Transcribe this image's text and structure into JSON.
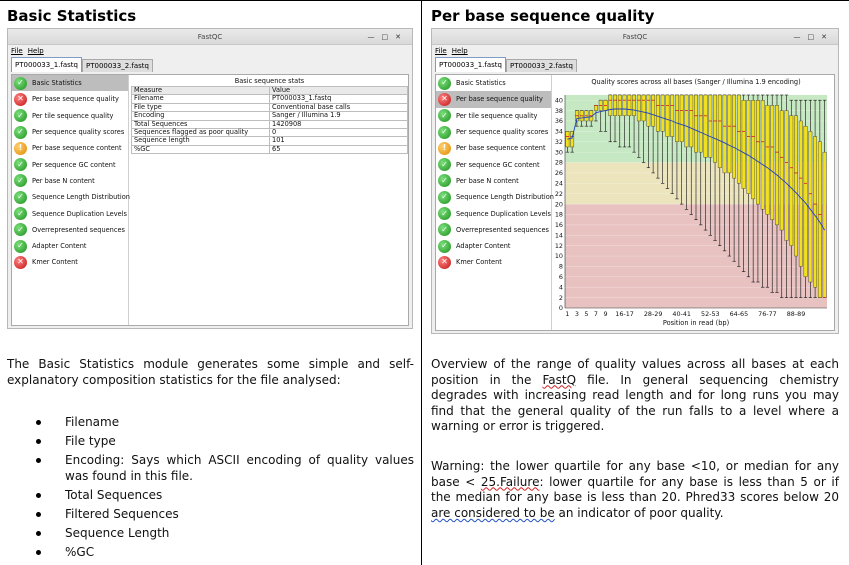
{
  "left": {
    "heading": "Basic Statistics",
    "window": {
      "title": "FastQC",
      "controls": [
        "—",
        "□",
        "✕"
      ],
      "menu": [
        "File",
        "Help"
      ],
      "tabs": [
        "PT000033_1.fastq",
        "PT000033_2.fastq"
      ],
      "stats": {
        "caption": "Basic sequence stats",
        "columns": [
          "Measure",
          "Value"
        ],
        "rows": [
          [
            "Filename",
            "PT000033_1.fastq"
          ],
          [
            "File type",
            "Conventional base calls"
          ],
          [
            "Encoding",
            "Sanger / Illumina 1.9"
          ],
          [
            "Total Sequences",
            "1420908"
          ],
          [
            "Sequences flagged as poor quality",
            "0"
          ],
          [
            "Sequence length",
            "101"
          ],
          [
            "%GC",
            "65"
          ]
        ]
      }
    },
    "description": "The Basic Statistics module generates some simple and self-explanatory composition statistics for the file analysed:",
    "bullets": [
      "Filename",
      "File type",
      "Encoding: Says which ASCII encoding of quality values was found in this file.",
      "Total Sequences",
      "Filtered Sequences",
      "Sequence Length",
      "%GC"
    ]
  },
  "modules": [
    {
      "label": "Basic Statistics",
      "status": "pass"
    },
    {
      "label": "Per base sequence quality",
      "status": "fail"
    },
    {
      "label": "Per tile sequence quality",
      "status": "pass"
    },
    {
      "label": "Per sequence quality scores",
      "status": "pass"
    },
    {
      "label": "Per base sequence content",
      "status": "warn"
    },
    {
      "label": "Per sequence GC content",
      "status": "pass"
    },
    {
      "label": "Per base N content",
      "status": "pass"
    },
    {
      "label": "Sequence Length Distribution",
      "status": "pass"
    },
    {
      "label": "Sequence Duplication Levels",
      "status": "pass"
    },
    {
      "label": "Overrepresented sequences",
      "status": "pass"
    },
    {
      "label": "Adapter Content",
      "status": "pass"
    },
    {
      "label": "Kmer Content",
      "status": "fail"
    }
  ],
  "status_colors": {
    "pass": "#2ca02c",
    "fail": "#d62728",
    "warn": "#f0a020"
  },
  "right": {
    "heading": "Per base sequence quality",
    "window": {
      "title": "FastQC",
      "controls": [
        "—",
        "□",
        "✕"
      ],
      "menu": [
        "File",
        "Help"
      ],
      "tabs": [
        "PT000033_1.fastq",
        "PT000033_2.fastq"
      ]
    },
    "para1": "Overview of the range of quality values across all bases at each position in the FastQ file. In general sequencing chemistry degrades with increasing read length and for long runs you may find that the general quality of the run falls to a level where a warning or error is triggered.",
    "para2": "Warning: the lower quartile for any base <10, or median for any base < 25.Failure: lower quartile for any base is less than 5 or if the median for any base is less than 20. Phred33 scores below 20 are considered to be an indicator of poor quality."
  },
  "chart_data": {
    "type": "box",
    "title": "Quality scores across all bases (Sanger / Illumina 1.9 encoding)",
    "xlabel": "Position in read (bp)",
    "ylabel": "",
    "ylim": [
      0,
      41
    ],
    "y_ticks": [
      0,
      2,
      4,
      6,
      8,
      10,
      12,
      14,
      16,
      18,
      20,
      22,
      24,
      26,
      28,
      30,
      32,
      34,
      36,
      38,
      40
    ],
    "x_tick_labels": [
      "1",
      "3",
      "5",
      "7",
      "9",
      "16-17",
      "28-29",
      "40-41",
      "52-53",
      "64-65",
      "76-77",
      "88-89"
    ],
    "bands": [
      {
        "from": 28,
        "to": 41,
        "color": "#c6e8c2"
      },
      {
        "from": 20,
        "to": 28,
        "color": "#ece4bd"
      },
      {
        "from": 0,
        "to": 20,
        "color": "#e8c1c1"
      }
    ],
    "box_color": "#f0e020",
    "median_color": "#cc2020",
    "mean_color": "#2040c0",
    "positions": [
      {
        "x": "1",
        "q1": 31,
        "median": 33,
        "q3": 34,
        "low": 30,
        "high": 34,
        "mean": 32.5
      },
      {
        "x": "2",
        "q1": 31,
        "median": 33,
        "q3": 34,
        "low": 30,
        "high": 34,
        "mean": 32.7
      },
      {
        "x": "3",
        "q1": 36,
        "median": 37,
        "q3": 38,
        "low": 35,
        "high": 38,
        "mean": 36.5
      },
      {
        "x": "4",
        "q1": 36,
        "median": 37,
        "q3": 38,
        "low": 35,
        "high": 38,
        "mean": 36.6
      },
      {
        "x": "5",
        "q1": 36,
        "median": 37,
        "q3": 38,
        "low": 35,
        "high": 38,
        "mean": 36.7
      },
      {
        "x": "6",
        "q1": 36,
        "median": 37,
        "q3": 38,
        "low": 35,
        "high": 38,
        "mean": 36.8
      },
      {
        "x": "7",
        "q1": 38,
        "median": 39,
        "q3": 39,
        "low": 36,
        "high": 39,
        "mean": 37.6
      },
      {
        "x": "8",
        "q1": 38,
        "median": 39,
        "q3": 40,
        "low": 34,
        "high": 40,
        "mean": 37.8
      },
      {
        "x": "9",
        "q1": 38,
        "median": 39,
        "q3": 40,
        "low": 34,
        "high": 40,
        "mean": 38.0
      },
      {
        "x": "10-11",
        "q1": 37,
        "median": 40,
        "q3": 41,
        "low": 32,
        "high": 41,
        "mean": 38.2
      },
      {
        "x": "12-13",
        "q1": 37,
        "median": 40,
        "q3": 41,
        "low": 32,
        "high": 41,
        "mean": 38.3
      },
      {
        "x": "14-15",
        "q1": 37,
        "median": 40,
        "q3": 41,
        "low": 31,
        "high": 41,
        "mean": 38.3
      },
      {
        "x": "16-17",
        "q1": 37,
        "median": 40,
        "q3": 41,
        "low": 31,
        "high": 41,
        "mean": 38.3
      },
      {
        "x": "18-19",
        "q1": 37,
        "median": 40,
        "q3": 41,
        "low": 31,
        "high": 41,
        "mean": 38.2
      },
      {
        "x": "20-21",
        "q1": 37,
        "median": 40,
        "q3": 41,
        "low": 30,
        "high": 41,
        "mean": 38.1
      },
      {
        "x": "22-23",
        "q1": 36,
        "median": 40,
        "q3": 41,
        "low": 29,
        "high": 41,
        "mean": 37.9
      },
      {
        "x": "24-25",
        "q1": 36,
        "median": 40,
        "q3": 41,
        "low": 28,
        "high": 41,
        "mean": 37.7
      },
      {
        "x": "26-27",
        "q1": 35,
        "median": 40,
        "q3": 41,
        "low": 27,
        "high": 41,
        "mean": 37.5
      },
      {
        "x": "28-29",
        "q1": 35,
        "median": 40,
        "q3": 41,
        "low": 26,
        "high": 41,
        "mean": 37.2
      },
      {
        "x": "30-31",
        "q1": 34,
        "median": 39,
        "q3": 41,
        "low": 25,
        "high": 41,
        "mean": 36.9
      },
      {
        "x": "32-33",
        "q1": 34,
        "median": 39,
        "q3": 41,
        "low": 24,
        "high": 41,
        "mean": 36.6
      },
      {
        "x": "34-35",
        "q1": 33,
        "median": 39,
        "q3": 41,
        "low": 23,
        "high": 41,
        "mean": 36.3
      },
      {
        "x": "36-37",
        "q1": 33,
        "median": 39,
        "q3": 41,
        "low": 22,
        "high": 41,
        "mean": 36.0
      },
      {
        "x": "38-39",
        "q1": 32,
        "median": 38,
        "q3": 41,
        "low": 21,
        "high": 41,
        "mean": 35.6
      },
      {
        "x": "40-41",
        "q1": 32,
        "median": 38,
        "q3": 41,
        "low": 20,
        "high": 41,
        "mean": 35.3
      },
      {
        "x": "42-43",
        "q1": 31,
        "median": 38,
        "q3": 41,
        "low": 19,
        "high": 41,
        "mean": 35.0
      },
      {
        "x": "44-45",
        "q1": 31,
        "median": 38,
        "q3": 41,
        "low": 18,
        "high": 41,
        "mean": 34.6
      },
      {
        "x": "46-47",
        "q1": 30,
        "median": 37,
        "q3": 41,
        "low": 17,
        "high": 41,
        "mean": 34.2
      },
      {
        "x": "48-49",
        "q1": 30,
        "median": 37,
        "q3": 41,
        "low": 16,
        "high": 41,
        "mean": 33.8
      },
      {
        "x": "50-51",
        "q1": 29,
        "median": 37,
        "q3": 41,
        "low": 15,
        "high": 41,
        "mean": 33.4
      },
      {
        "x": "52-53",
        "q1": 29,
        "median": 36,
        "q3": 41,
        "low": 14,
        "high": 41,
        "mean": 33.0
      },
      {
        "x": "54-55",
        "q1": 28,
        "median": 36,
        "q3": 41,
        "low": 13,
        "high": 41,
        "mean": 32.6
      },
      {
        "x": "56-57",
        "q1": 27,
        "median": 36,
        "q3": 41,
        "low": 12,
        "high": 41,
        "mean": 32.2
      },
      {
        "x": "58-59",
        "q1": 26,
        "median": 35,
        "q3": 41,
        "low": 11,
        "high": 41,
        "mean": 31.8
      },
      {
        "x": "60-61",
        "q1": 26,
        "median": 35,
        "q3": 41,
        "low": 10,
        "high": 41,
        "mean": 31.3
      },
      {
        "x": "62-63",
        "q1": 25,
        "median": 35,
        "q3": 41,
        "low": 9,
        "high": 41,
        "mean": 30.9
      },
      {
        "x": "64-65",
        "q1": 24,
        "median": 34,
        "q3": 41,
        "low": 8,
        "high": 41,
        "mean": 30.4
      },
      {
        "x": "66-67",
        "q1": 23,
        "median": 34,
        "q3": 40,
        "low": 7,
        "high": 41,
        "mean": 29.9
      },
      {
        "x": "68-69",
        "q1": 22,
        "median": 33,
        "q3": 40,
        "low": 6,
        "high": 41,
        "mean": 29.4
      },
      {
        "x": "70-71",
        "q1": 21,
        "median": 33,
        "q3": 40,
        "low": 5,
        "high": 41,
        "mean": 28.8
      },
      {
        "x": "72-73",
        "q1": 20,
        "median": 32,
        "q3": 40,
        "low": 5,
        "high": 41,
        "mean": 28.2
      },
      {
        "x": "74-75",
        "q1": 19,
        "median": 32,
        "q3": 40,
        "low": 4,
        "high": 41,
        "mean": 27.6
      },
      {
        "x": "76-77",
        "q1": 18,
        "median": 31,
        "q3": 39,
        "low": 4,
        "high": 41,
        "mean": 27.0
      },
      {
        "x": "78-79",
        "q1": 17,
        "median": 31,
        "q3": 39,
        "low": 3,
        "high": 41,
        "mean": 26.3
      },
      {
        "x": "80-81",
        "q1": 16,
        "median": 30,
        "q3": 39,
        "low": 3,
        "high": 41,
        "mean": 25.6
      },
      {
        "x": "82-83",
        "q1": 15,
        "median": 29,
        "q3": 38,
        "low": 2,
        "high": 41,
        "mean": 24.8
      },
      {
        "x": "84-85",
        "q1": 13,
        "median": 28,
        "q3": 38,
        "low": 2,
        "high": 41,
        "mean": 24.0
      },
      {
        "x": "86-87",
        "q1": 12,
        "median": 27,
        "q3": 37,
        "low": 2,
        "high": 40,
        "mean": 23.1
      },
      {
        "x": "88-89",
        "q1": 10,
        "median": 26,
        "q3": 37,
        "low": 2,
        "high": 40,
        "mean": 22.2
      },
      {
        "x": "90-91",
        "q1": 8,
        "median": 25,
        "q3": 36,
        "low": 2,
        "high": 40,
        "mean": 21.2
      },
      {
        "x": "92-93",
        "q1": 6,
        "median": 24,
        "q3": 35,
        "low": 2,
        "high": 40,
        "mean": 20.2
      },
      {
        "x": "94-95",
        "q1": 5,
        "median": 22,
        "q3": 34,
        "low": 2,
        "high": 40,
        "mean": 19.0
      },
      {
        "x": "96-97",
        "q1": 4,
        "median": 20,
        "q3": 33,
        "low": 2,
        "high": 40,
        "mean": 17.8
      },
      {
        "x": "98-99",
        "q1": 2,
        "median": 18,
        "q3": 32,
        "low": 2,
        "high": 40,
        "mean": 16.5
      },
      {
        "x": "100-101",
        "q1": 2,
        "median": 2,
        "q3": 30,
        "low": 2,
        "high": 40,
        "mean": 15.0
      }
    ]
  }
}
